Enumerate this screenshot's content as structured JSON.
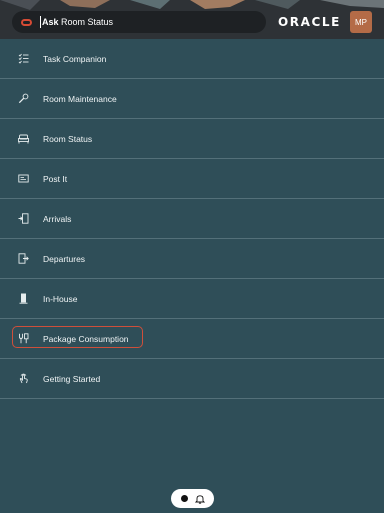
{
  "header": {
    "ask_prefix": "Ask",
    "ask_value": "Room Status",
    "logo": "ORACLE",
    "avatar_initials": "MP",
    "accent_color": "#d64b35"
  },
  "menu": {
    "items": [
      {
        "label": "Task Companion",
        "icon": "task-checklist-icon"
      },
      {
        "label": "Room Maintenance",
        "icon": "wrench-icon"
      },
      {
        "label": "Room Status",
        "icon": "bed-icon"
      },
      {
        "label": "Post It",
        "icon": "sticky-note-icon"
      },
      {
        "label": "Arrivals",
        "icon": "door-enter-icon"
      },
      {
        "label": "Departures",
        "icon": "door-exit-icon"
      },
      {
        "label": "In-House",
        "icon": "building-icon"
      },
      {
        "label": "Package Consumption",
        "icon": "package-icon",
        "active": true
      },
      {
        "label": "Getting Started",
        "icon": "hand-pointer-icon"
      }
    ]
  },
  "bottom_bar": {
    "icons": [
      "dot-icon",
      "bell-icon"
    ]
  }
}
